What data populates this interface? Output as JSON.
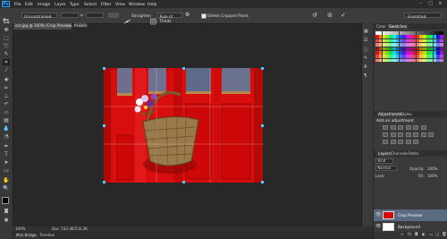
{
  "app": {
    "logo": "Ps"
  },
  "menu": [
    "File",
    "Edit",
    "Image",
    "Layer",
    "Type",
    "Select",
    "Filter",
    "View",
    "Window",
    "Help"
  ],
  "window_controls": [
    "–",
    "□",
    "×"
  ],
  "options": {
    "ratio": "Unconstrained",
    "straighten_label": "Straighten",
    "overlay": "Rule of Thirds",
    "delete_cropped_label": "Delete Cropped Pixels",
    "workspace": "Essentials"
  },
  "document": {
    "tab_title": "cor.jpg @ 100% (Crop Preview, RGB/8)"
  },
  "status": {
    "zoom": "100%",
    "doc_size": "Doc: 533.3K/533.3K"
  },
  "bottom_tabs": [
    "Mini Bridge",
    "Timeline"
  ],
  "panels": {
    "color_tabs": [
      "Color",
      "Swatches"
    ],
    "adjustments_tabs": [
      "Adjustments",
      "Styles"
    ],
    "adjustments_title": "Add an adjustment",
    "layers_tabs": [
      "Layers",
      "Channels",
      "Paths"
    ],
    "layer_filter": "Kind",
    "blend_mode": "Normal",
    "opacity_label": "Opacity:",
    "opacity_value": "100%",
    "lock_label": "Lock:",
    "fill_label": "Fill:",
    "fill_value": "100%",
    "layers": [
      {
        "name": "Crop Preview",
        "selected": true,
        "visible": true
      },
      {
        "name": "Background",
        "selected": false,
        "visible": true
      }
    ]
  },
  "colors": {
    "accent_blue": "#46d0ff",
    "door_red": "#e01010",
    "panel_bg": "#3a3a3a",
    "canvas_bg": "#282828"
  }
}
